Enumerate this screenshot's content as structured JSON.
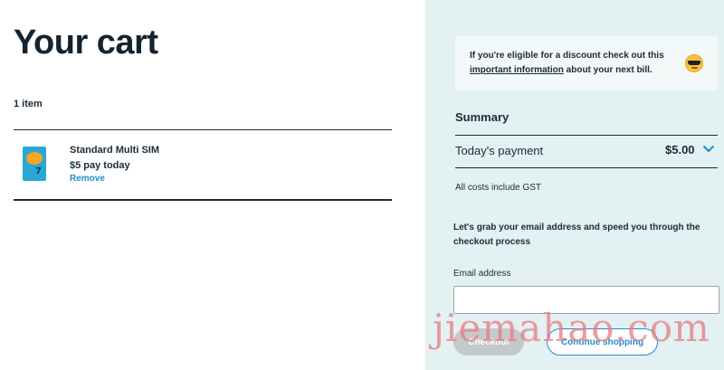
{
  "cart": {
    "title": "Your cart",
    "item_count": "1 item",
    "items": [
      {
        "name": "Standard Multi SIM",
        "price_text": "$5 pay today",
        "remove_label": "Remove",
        "thumbnail_icon": "sim-card-pack-icon"
      }
    ]
  },
  "notice": {
    "text_before": "If you're eligible for a discount check out this ",
    "link_text": "important information",
    "text_after": " about your next bill.",
    "icon": "sunglasses-emoji-icon"
  },
  "summary": {
    "title": "Summary",
    "payment_label": "Today's payment",
    "payment_amount": "$5.00",
    "expand_icon": "chevron-down-icon",
    "gst_note": "All costs include GST"
  },
  "checkout_form": {
    "prompt": "Let's grab your email address and speed you through the checkout process",
    "email_label": "Email address",
    "email_value": "",
    "email_placeholder": "",
    "checkout_label": "Checkout",
    "continue_label": "Continue shopping"
  },
  "watermark": "jiemahao.com",
  "colors": {
    "accent": "#1d8fc9",
    "panel_bg": "#e3f1f2",
    "text": "#1b2b3a",
    "disabled_button": "#c4c9cc",
    "watermark": "#e97882"
  }
}
